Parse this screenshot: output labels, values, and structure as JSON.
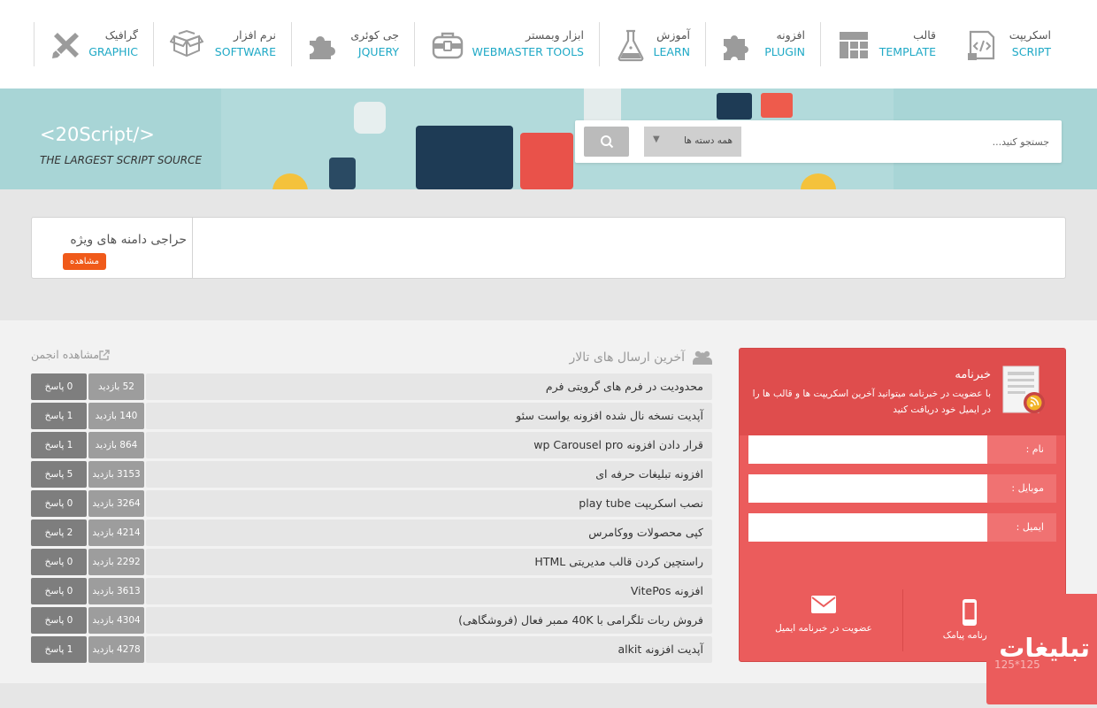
{
  "nav": {
    "items": [
      {
        "fa": "اسکریپت",
        "en": "SCRIPT",
        "icon": "script-file-icon"
      },
      {
        "fa": "قالب",
        "en": "TEMPLATE",
        "icon": "template-grid-icon"
      },
      {
        "fa": "افزونه",
        "en": "PLUGIN",
        "icon": "puzzle-icon"
      },
      {
        "fa": "آموزش",
        "en": "LEARN",
        "icon": "flask-icon"
      },
      {
        "fa": "ابزار وبمستر",
        "en": "WEBMASTER TOOLS",
        "icon": "toolbox-icon"
      },
      {
        "fa": "جی کوئری",
        "en": "JQUERY",
        "icon": "puzzle-piece-icon"
      },
      {
        "fa": "نرم افزار",
        "en": "SOFTWARE",
        "icon": "open-box-icon"
      },
      {
        "fa": "گرافیک",
        "en": "GRAPHIC",
        "icon": "pencil-ruler-icon"
      }
    ]
  },
  "hero": {
    "brand": "<20Script/>",
    "tagline": "THE LARGEST SCRIPT SOURCE",
    "search": {
      "placeholder": "جستجو کنید...",
      "category": "همه دسته ها"
    }
  },
  "promo": {
    "title": "حراجی دامنه های ویژه",
    "badge": "مشاهده"
  },
  "forum": {
    "title": "آخرین ارسال های تالار",
    "link": "مشاهده انجمن",
    "rows": [
      {
        "title": "محدودیت در فرم های گرویتی فرم",
        "views": "52 بازدید",
        "replies": "0 پاسخ"
      },
      {
        "title": "آپدیت نسخه نال شده افزونه یواست سئو",
        "views": "140 بازدید",
        "replies": "1 پاسخ"
      },
      {
        "title": "قرار دادن افزونه wp Carousel pro",
        "views": "864 بازدید",
        "replies": "1 پاسخ"
      },
      {
        "title": "افزونه تبلیغات حرفه ای",
        "views": "3153 بازدید",
        "replies": "5 پاسخ"
      },
      {
        "title": "نصب اسکریپت play tube",
        "views": "3264 بازدید",
        "replies": "0 پاسخ"
      },
      {
        "title": "کپی محصولات ووکامرس",
        "views": "4214 بازدید",
        "replies": "2 پاسخ"
      },
      {
        "title": "راستچین کردن قالب مدیریتی HTML",
        "views": "2292 بازدید",
        "replies": "0 پاسخ"
      },
      {
        "title": "افزونه VitePos",
        "views": "3613 بازدید",
        "replies": "0 پاسخ"
      },
      {
        "title": "فروش ربات تلگرامی با 40K ممبر فعال (فروشگاهی)",
        "views": "4304 بازدید",
        "replies": "0 پاسخ"
      },
      {
        "title": "آپدیت افزونه alkit",
        "views": "4278 بازدید",
        "replies": "1 پاسخ"
      }
    ]
  },
  "newsletter": {
    "title": "خبرنامه",
    "description": "با عضویت در خبرنامه میتوانید آخرین اسکریپت ها و قالب ها را در ایمیل خود دریافت کنید",
    "fields": [
      {
        "label": "نام :"
      },
      {
        "label": "موبایل :"
      },
      {
        "label": "ایمیل :"
      }
    ],
    "email_button": "عضویت در خبرنامه ایمیل",
    "sms_button": "خبرنامه پیامک"
  },
  "ad": {
    "text": "تبلیغات",
    "size": "125*125"
  },
  "colors": {
    "accent": "#1fa9c6",
    "newsletter": "#eb5c5c",
    "badge": "#f05a1a",
    "hero": "#a8d5d6"
  }
}
